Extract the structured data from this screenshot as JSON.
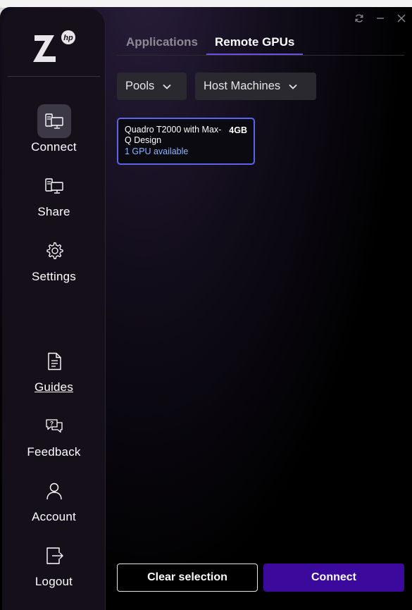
{
  "sidebar": {
    "logo_letter": "Z",
    "logo_badge": "hp",
    "items_top": [
      {
        "label": "Connect",
        "icon": "monitor-icon"
      },
      {
        "label": "Share",
        "icon": "monitor-share-icon"
      },
      {
        "label": "Settings",
        "icon": "gear-icon"
      }
    ],
    "items_bottom": [
      {
        "label": "Guides",
        "icon": "document-icon"
      },
      {
        "label": "Feedback",
        "icon": "chat-question-icon"
      },
      {
        "label": "Account",
        "icon": "user-icon"
      },
      {
        "label": "Logout",
        "icon": "logout-icon"
      }
    ]
  },
  "tabs": [
    {
      "label": "Applications"
    },
    {
      "label": "Remote GPUs"
    }
  ],
  "filters": {
    "pools_label": "Pools",
    "host_machines_label": "Host Machines"
  },
  "gpu_card": {
    "name": "Quadro T2000 with Max-Q Design",
    "memory": "4GB",
    "availability": "1 GPU available"
  },
  "footer": {
    "clear_label": "Clear selection",
    "connect_label": "Connect"
  },
  "colors": {
    "accent": "#3b0a9c",
    "card_border": "#5f63e8",
    "availability_text": "#8eb4ff"
  }
}
